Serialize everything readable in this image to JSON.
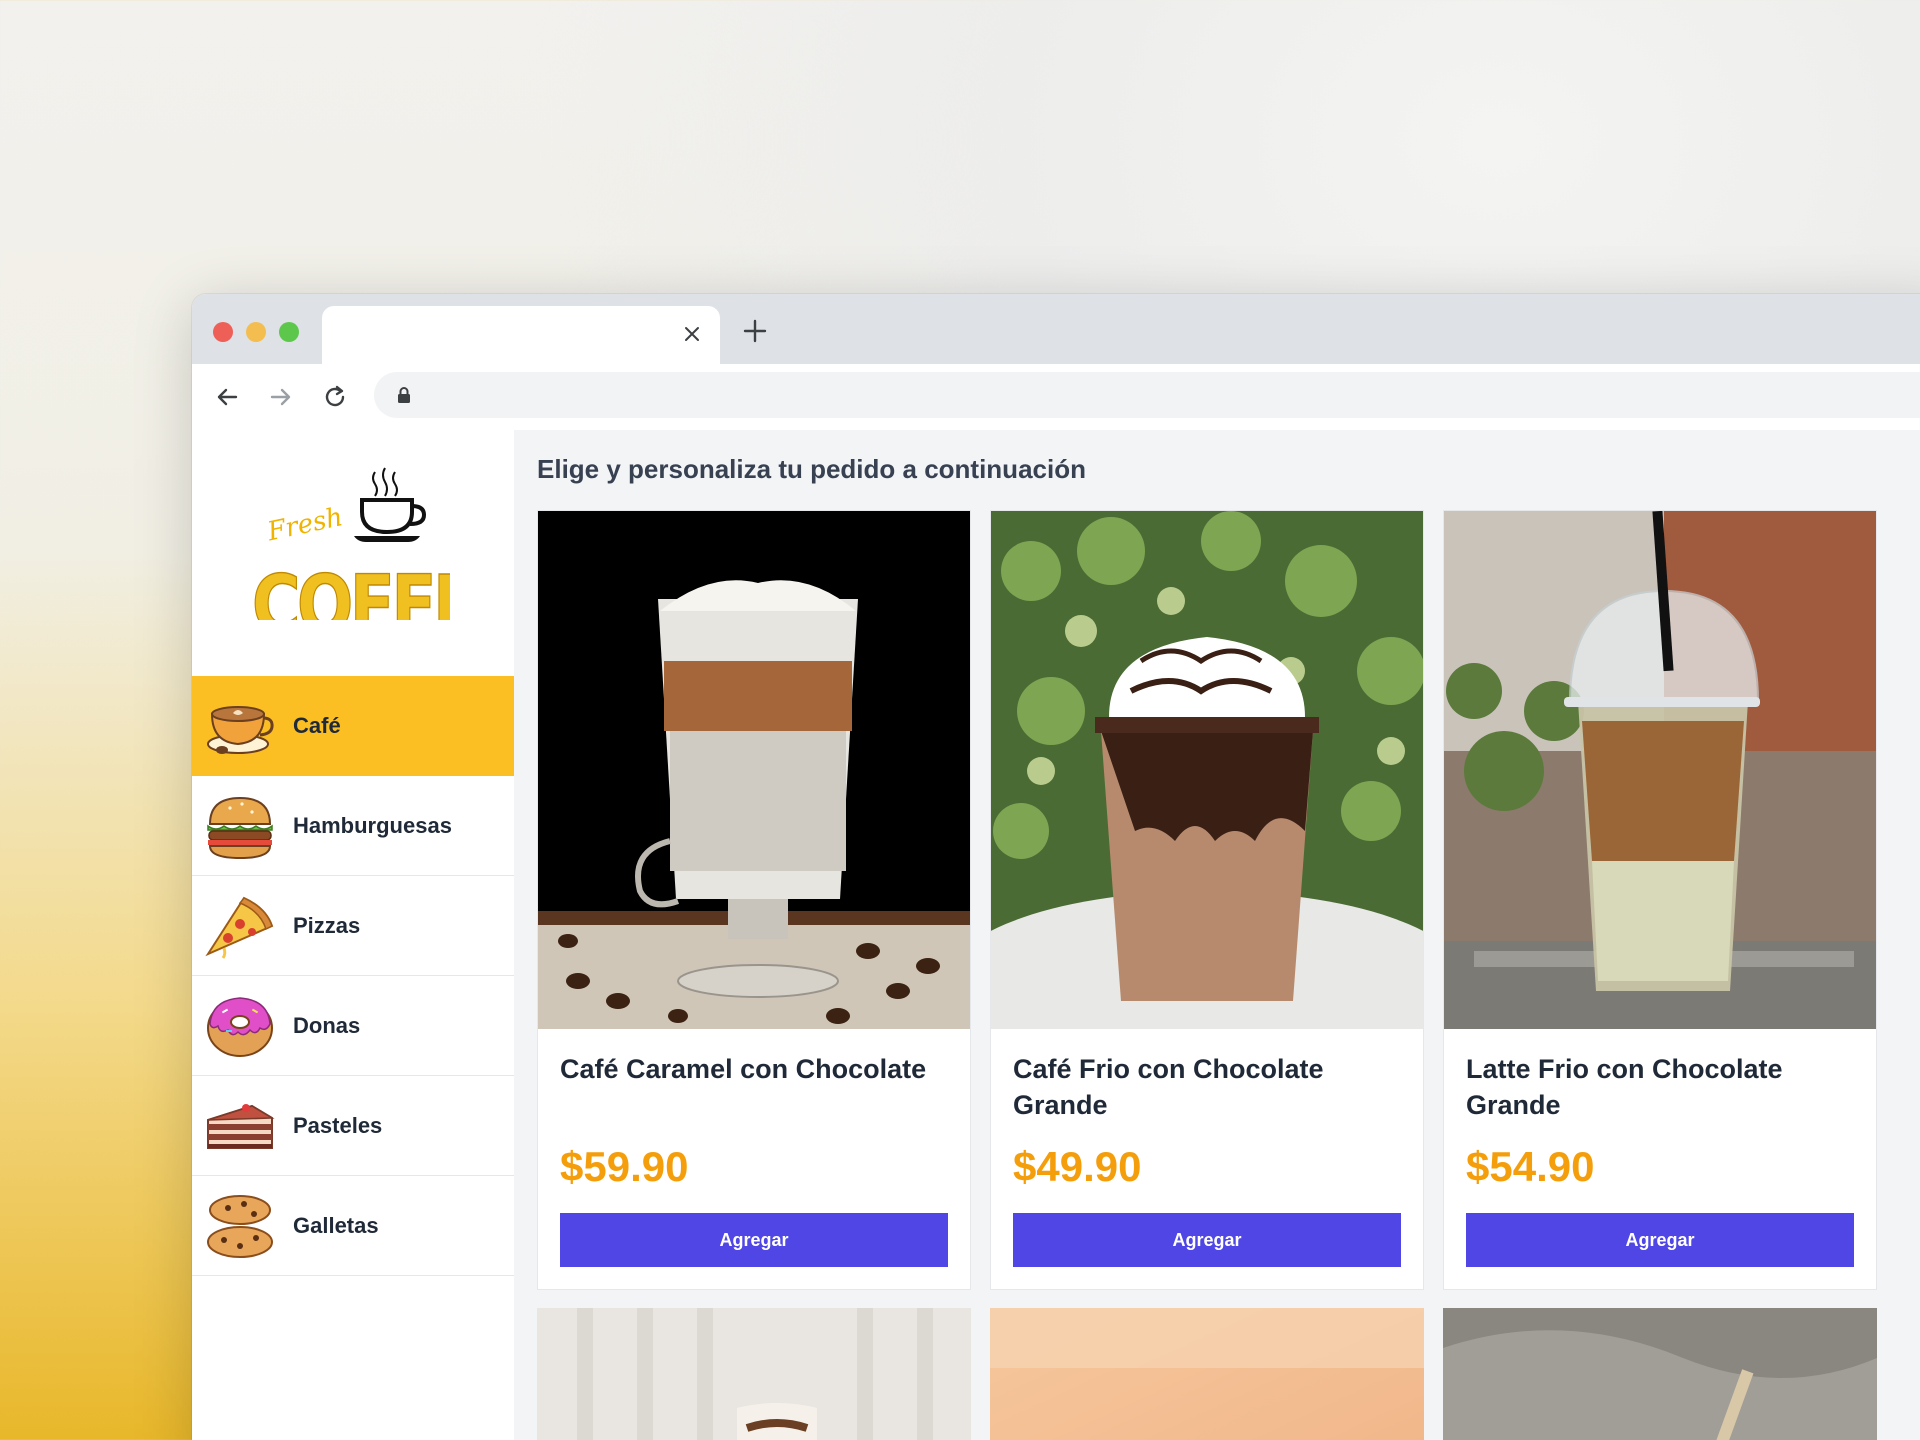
{
  "browser": {
    "tab_title": "",
    "address_url": ""
  },
  "sidebar": {
    "logo_text": [
      "Fresh",
      "COFFEE"
    ],
    "categories": [
      {
        "label": "Café",
        "icon": "coffee-cup-icon",
        "active": true
      },
      {
        "label": "Hamburguesas",
        "icon": "hamburger-icon",
        "active": false
      },
      {
        "label": "Pizzas",
        "icon": "pizza-slice-icon",
        "active": false
      },
      {
        "label": "Donas",
        "icon": "donut-icon",
        "active": false
      },
      {
        "label": "Pasteles",
        "icon": "cake-icon",
        "active": false
      },
      {
        "label": "Galletas",
        "icon": "cookies-icon",
        "active": false
      }
    ]
  },
  "main": {
    "heading": "Elige y personaliza tu pedido a continuación",
    "products": [
      {
        "name": "Café Caramel con Chocolate",
        "price": "$59.90",
        "button": "Agregar",
        "image": "layered-latte-glass"
      },
      {
        "name": "Café Frio con Chocolate Grande",
        "price": "$49.90",
        "button": "Agregar",
        "image": "chocolate-frappe-whipped-cream"
      },
      {
        "name": "Latte Frio con Chocolate Grande",
        "price": "$54.90",
        "button": "Agregar",
        "image": "iced-latte-cup-with-straw"
      }
    ]
  },
  "colors": {
    "accent_active": "#fbbf24",
    "price": "#f59e0b",
    "button": "#4f46e5"
  }
}
